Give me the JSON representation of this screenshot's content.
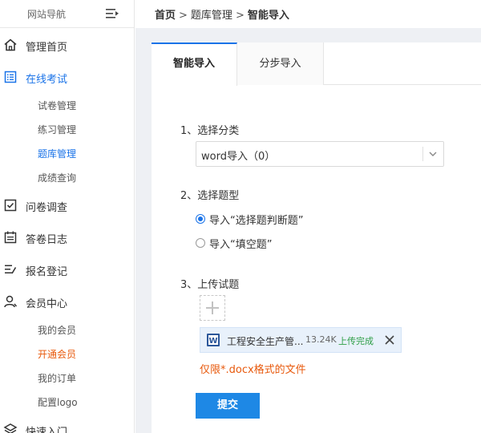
{
  "sidebar": {
    "title": "网站导航",
    "menu": [
      {
        "label": "管理首页",
        "icon": "home-icon"
      },
      {
        "label": "在线考试",
        "icon": "list-icon",
        "active": true,
        "children": [
          {
            "label": "试卷管理"
          },
          {
            "label": "练习管理"
          },
          {
            "label": "题库管理",
            "active": true
          },
          {
            "label": "成绩查询"
          }
        ]
      },
      {
        "label": "问卷调查",
        "icon": "checkbox-icon"
      },
      {
        "label": "答卷日志",
        "icon": "calendar-icon"
      },
      {
        "label": "报名登记",
        "icon": "edit-list-icon"
      },
      {
        "label": "会员中心",
        "icon": "user-icon",
        "children": [
          {
            "label": "我的会员"
          },
          {
            "label": "开通会员",
            "highlight": true
          },
          {
            "label": "我的订单"
          },
          {
            "label": "配置logo"
          }
        ]
      },
      {
        "label": "快速入门",
        "icon": "layers-icon"
      }
    ]
  },
  "breadcrumb": {
    "home": "首页",
    "sep": ">",
    "level2": "题库管理",
    "current": "智能导入"
  },
  "tabs": [
    {
      "label": "智能导入",
      "active": true
    },
    {
      "label": "分步导入",
      "active": false
    }
  ],
  "form": {
    "step1": {
      "title": "1、选择分类",
      "select_value": "word导入（0）"
    },
    "step2": {
      "title": "2、选择题型",
      "options": [
        {
          "label": "导入“选择题判断题”",
          "checked": true
        },
        {
          "label": "导入“填空题”",
          "checked": false
        }
      ]
    },
    "step3": {
      "title": "3、上传试题",
      "file": {
        "name": "工程安全生产管...",
        "size": "13.24K",
        "status": "上传完成"
      },
      "hint": "仅限*.docx格式的文件"
    },
    "submit_label": "提交"
  },
  "colors": {
    "accent": "#1a73e8",
    "hint": "#e8590c",
    "success": "#2e9e46",
    "button": "#1e88e5"
  }
}
